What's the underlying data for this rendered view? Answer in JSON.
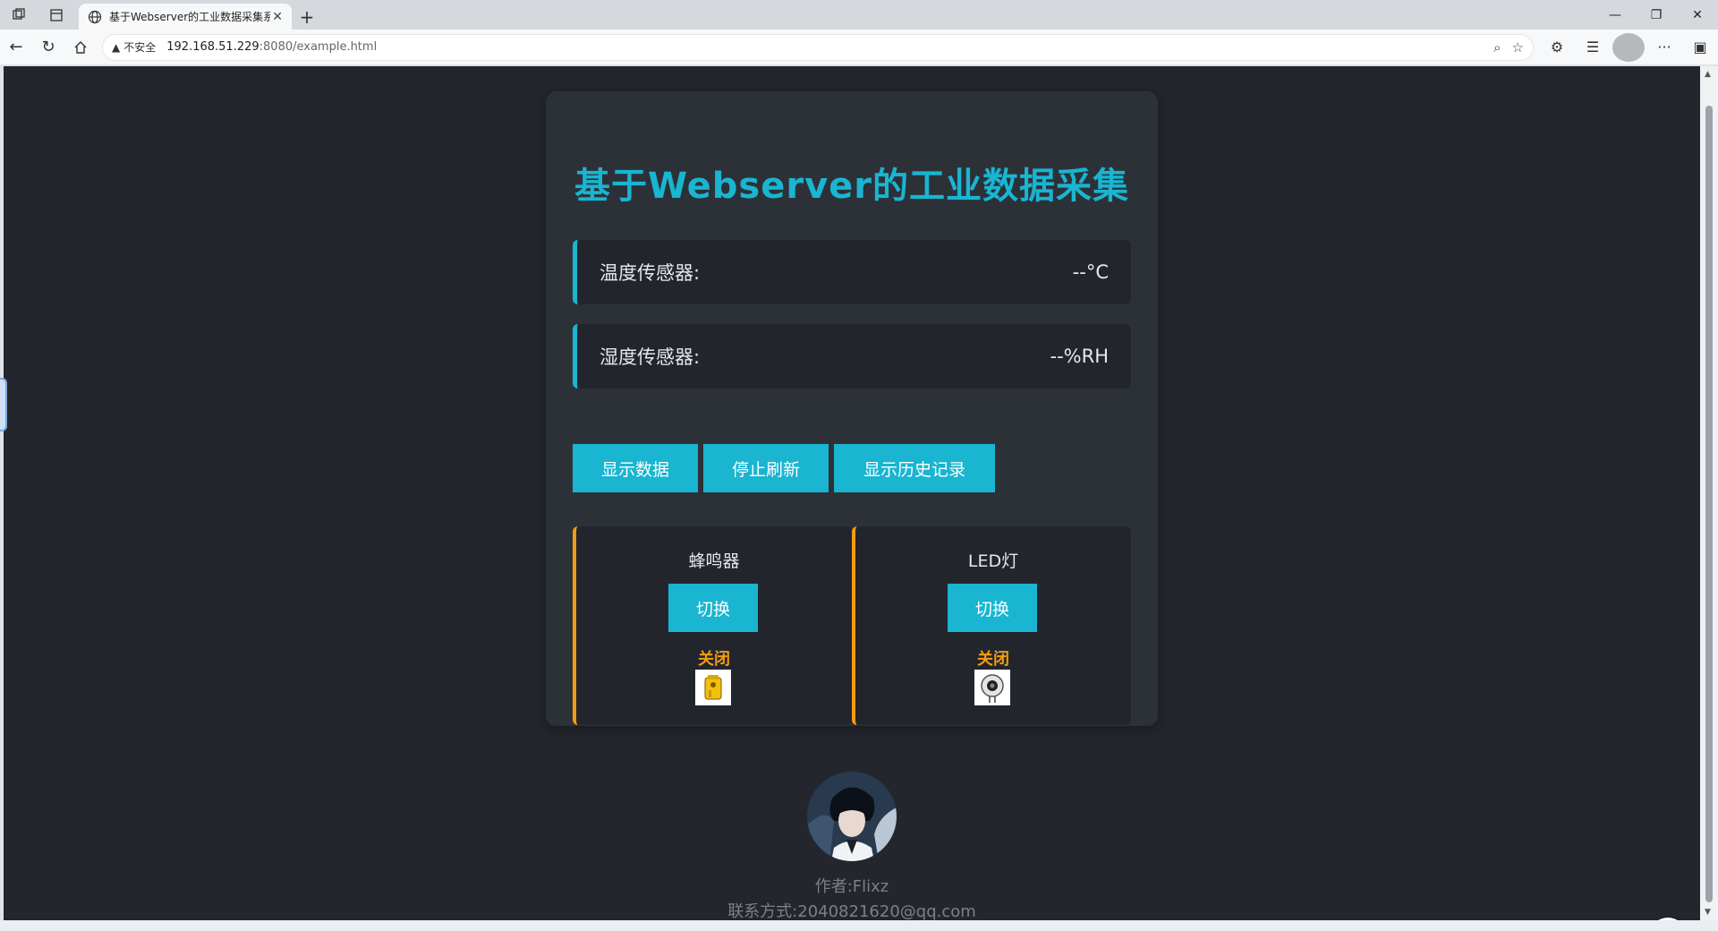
{
  "browser": {
    "tab_title": "基于Webserver的工业数据采集系",
    "address_insecure": "不安全",
    "address_host": "192.168.51.229",
    "address_path": ":8080/example.html"
  },
  "page": {
    "title": "基于Webserver的工业数据采集",
    "sensors": [
      {
        "label": "温度传感器:",
        "value": "--°C"
      },
      {
        "label": "湿度传感器:",
        "value": "--%RH"
      }
    ],
    "buttons": {
      "show_data": "显示数据",
      "stop_refresh": "停止刷新",
      "show_history": "显示历史记录"
    },
    "devices": [
      {
        "name": "蜂鸣器",
        "toggle": "切换",
        "state": "关闭"
      },
      {
        "name": "LED灯",
        "toggle": "切换",
        "state": "关闭"
      }
    ],
    "footer": {
      "author": "作者:Flixz",
      "contact": "联系方式:2040821620@qq.com"
    }
  },
  "colors": {
    "accent": "#19b5d1",
    "device_accent": "#f39c12",
    "page_bg": "#23272d",
    "card_bg": "#2c3138"
  },
  "icons": [
    "tab-group-icon",
    "tab-panel-icon",
    "globe-icon",
    "close-icon",
    "plus-icon",
    "minimize-icon",
    "restore-icon",
    "back-icon",
    "reload-icon",
    "home-icon",
    "warning-icon",
    "zoom-icon",
    "star-icon",
    "extensions-icon",
    "favorites-icon",
    "profile-icon",
    "more-icon",
    "sidebar-icon",
    "buzzer-icon",
    "led-icon",
    "avatar-icon",
    "copilot-icon"
  ]
}
